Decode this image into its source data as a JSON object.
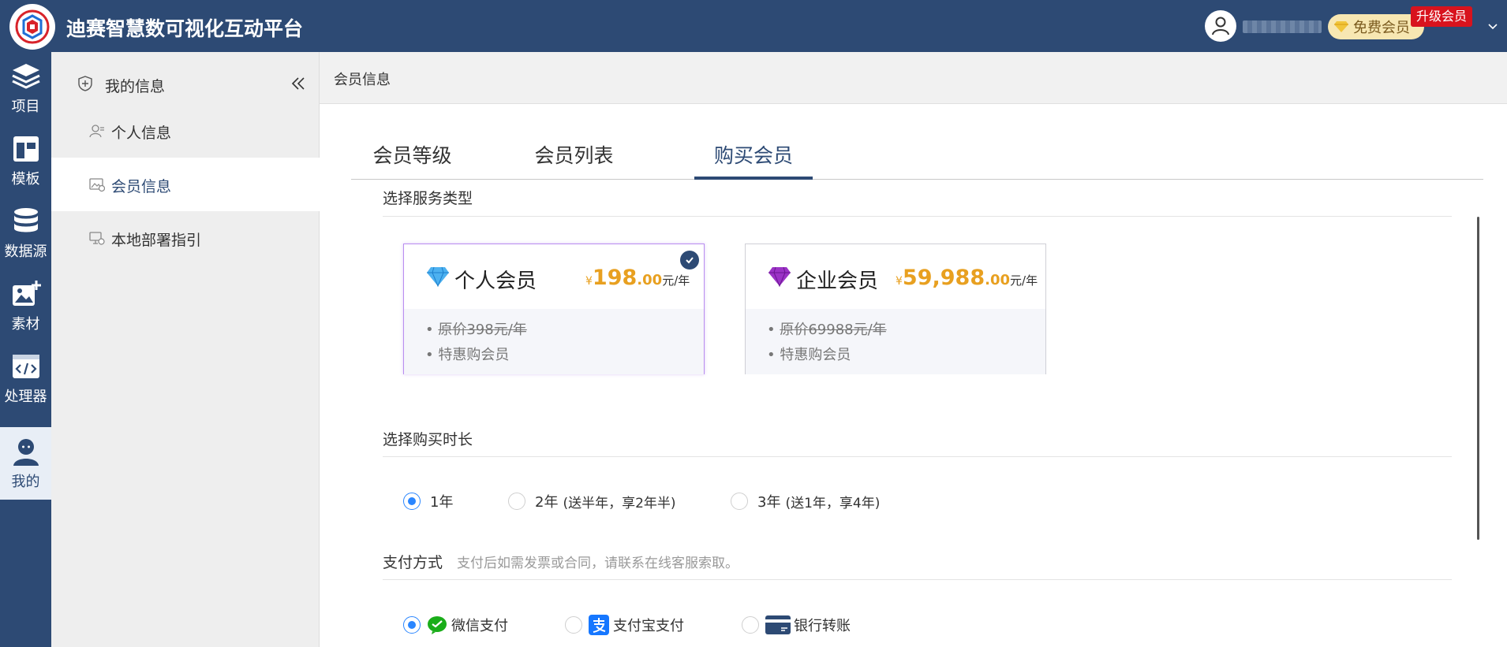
{
  "app": {
    "title": "迪赛智慧数可视化互动平台",
    "brand_color": "#2d4a74",
    "accent_color": "#e8a020"
  },
  "topbar": {
    "member_badge": "免费会员",
    "upgrade_label": "升级会员",
    "icons": [
      "user-avatar-icon",
      "gem-icon",
      "chevron-down-icon"
    ]
  },
  "rail": {
    "items": [
      {
        "label": "项目",
        "icon": "layers-icon"
      },
      {
        "label": "模板",
        "icon": "template-icon"
      },
      {
        "label": "数据源",
        "icon": "database-icon"
      },
      {
        "label": "素材",
        "icon": "image-add-icon"
      },
      {
        "label": "处理器",
        "icon": "code-icon"
      },
      {
        "label": "我的",
        "icon": "user-icon",
        "active": true
      }
    ]
  },
  "sidebar": {
    "header": "我的信息",
    "items": [
      {
        "label": "个人信息",
        "icon": "person-card-icon"
      },
      {
        "label": "会员信息",
        "icon": "member-card-icon",
        "active": true
      },
      {
        "label": "本地部署指引",
        "icon": "deploy-icon"
      }
    ]
  },
  "breadcrumb": "会员信息",
  "tabs": [
    {
      "label": "会员等级"
    },
    {
      "label": "会员列表"
    },
    {
      "label": "购买会员",
      "active": true
    }
  ],
  "service": {
    "title": "选择服务类型",
    "plans": [
      {
        "name": "个人会员",
        "currency": "¥",
        "price_int": "198",
        "price_dec": ".00",
        "unit": "元/年",
        "features": [
          "原价398元/年",
          "特惠购会员"
        ],
        "selected": true,
        "gem_color": "#3aa0e8"
      },
      {
        "name": "企业会员",
        "currency": "¥",
        "price_int": "59,988",
        "price_dec": ".00",
        "unit": "元/年",
        "features": [
          "原价69988元/年",
          "特惠购会员"
        ],
        "selected": false,
        "gem_color": "#8e2bb8"
      }
    ]
  },
  "duration": {
    "title": "选择购买时长",
    "options": [
      {
        "label": "1年",
        "note": "",
        "selected": true
      },
      {
        "label": "2年",
        "note": "(送半年，享2年半)",
        "selected": false
      },
      {
        "label": "3年",
        "note": "(送1年，享4年)",
        "selected": false
      }
    ]
  },
  "payment": {
    "title": "支付方式",
    "hint": "支付后如需发票或合同，请联系在线客服索取。",
    "options": [
      {
        "label": "微信支付",
        "icon": "wechat-pay-icon",
        "selected": true
      },
      {
        "label": "支付宝支付",
        "icon": "alipay-icon",
        "selected": false
      },
      {
        "label": "银行转账",
        "icon": "bank-card-icon",
        "selected": false
      }
    ]
  }
}
